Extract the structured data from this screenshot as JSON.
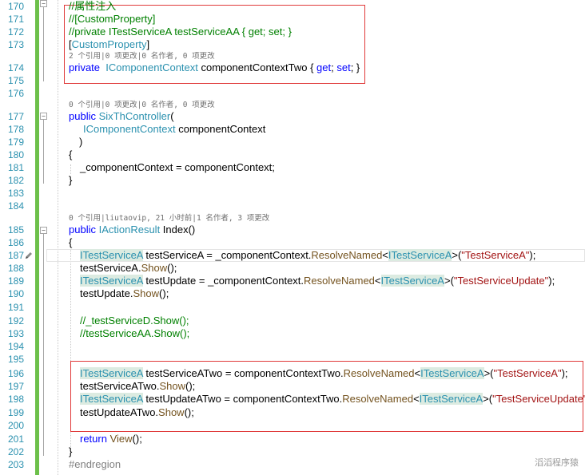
{
  "editor": {
    "accent_change_bar": "#6cc04a",
    "highlight_box_color": "#e03a3a",
    "watermark": "滔滔程序猿"
  },
  "lines": {
    "l170": {
      "num": "170",
      "text": "//属性注入"
    },
    "l171": {
      "num": "171",
      "text": "//[CustomProperty]"
    },
    "l172": {
      "num": "172",
      "text": "//private ITestServiceA testServiceAA { get; set; }"
    },
    "l173": {
      "num": "173",
      "p1": "[",
      "p2": "CustomProperty",
      "p3": "]"
    },
    "lens174": "2 个引用|0 项更改|0 名作者, 0 项更改",
    "l174": {
      "num": "174",
      "kw": "private",
      "type": "IComponentContext",
      "rest": " componentContextTwo { ",
      "get": "get",
      "semi1": "; ",
      "set": "set",
      "semi2": "; }"
    },
    "l175": {
      "num": "175"
    },
    "l176": {
      "num": "176"
    },
    "lens177": "0 个引用|0 项更改|0 名作者, 0 项更改",
    "l177": {
      "num": "177",
      "kw": "public",
      "type": "SixThController",
      "rest": "("
    },
    "l178": {
      "num": "178",
      "type": "IComponentContext",
      "rest": " componentContext"
    },
    "l179": {
      "num": "179",
      "text": ")"
    },
    "l180": {
      "num": "180",
      "text": "{"
    },
    "l181": {
      "num": "181",
      "text": "_componentContext = componentContext;"
    },
    "l182": {
      "num": "182",
      "text": "}"
    },
    "l183": {
      "num": "183"
    },
    "l184": {
      "num": "184"
    },
    "lens185": "0 个引用|liutaovip, 21 小时前|1 名作者, 3 项更改",
    "l185": {
      "num": "185",
      "kw": "public",
      "type": "IActionResult",
      "rest": " Index()"
    },
    "l186": {
      "num": "186",
      "text": "{"
    },
    "l187": {
      "num": "187",
      "t1": "ITestServiceA",
      "a": " testServiceA = _componentContext.",
      "m": "ResolveNamed",
      "b": "<",
      "t2": "ITestServiceA",
      "c": ">(",
      "s": "\"TestServiceA\"",
      "d": ");"
    },
    "l188": {
      "num": "188",
      "a": "testServiceA.",
      "m": "Show",
      "b": "();"
    },
    "l189": {
      "num": "189",
      "t1": "ITestServiceA",
      "a": " testUpdate = _componentContext.",
      "m": "ResolveNamed",
      "b": "<",
      "t2": "ITestServiceA",
      "c": ">(",
      "s": "\"TestServiceUpdate\"",
      "d": ");"
    },
    "l190": {
      "num": "190",
      "a": "testUpdate.",
      "m": "Show",
      "b": "();"
    },
    "l191": {
      "num": "191"
    },
    "l192": {
      "num": "192",
      "text": "//_testServiceD.Show();"
    },
    "l193": {
      "num": "193",
      "text": "//testServiceAA.Show();"
    },
    "l194": {
      "num": "194"
    },
    "l195": {
      "num": "195"
    },
    "l196": {
      "num": "196",
      "t1": "ITestServiceA",
      "a": " testServiceATwo = componentContextTwo.",
      "m": "ResolveNamed",
      "b": "<",
      "t2": "ITestServiceA",
      "c": ">(",
      "s": "\"TestServiceA\"",
      "d": ");"
    },
    "l197": {
      "num": "197",
      "a": "testServiceATwo.",
      "m": "Show",
      "b": "();"
    },
    "l198": {
      "num": "198",
      "t1": "ITestServiceA",
      "a": " testUpdateATwo = componentContextTwo.",
      "m": "ResolveNamed",
      "b": "<",
      "t2": "ITestServiceA",
      "c": ">(",
      "s": "\"TestServiceUpdate\"",
      "d": ");"
    },
    "l199": {
      "num": "199",
      "a": "testUpdateATwo.",
      "m": "Show",
      "b": "();"
    },
    "l200": {
      "num": "200"
    },
    "l201": {
      "num": "201",
      "kw": "return",
      "m": "View",
      "b": "();"
    },
    "l202": {
      "num": "202",
      "text": "}"
    },
    "l203": {
      "num": "203",
      "text": "#endregion"
    }
  }
}
